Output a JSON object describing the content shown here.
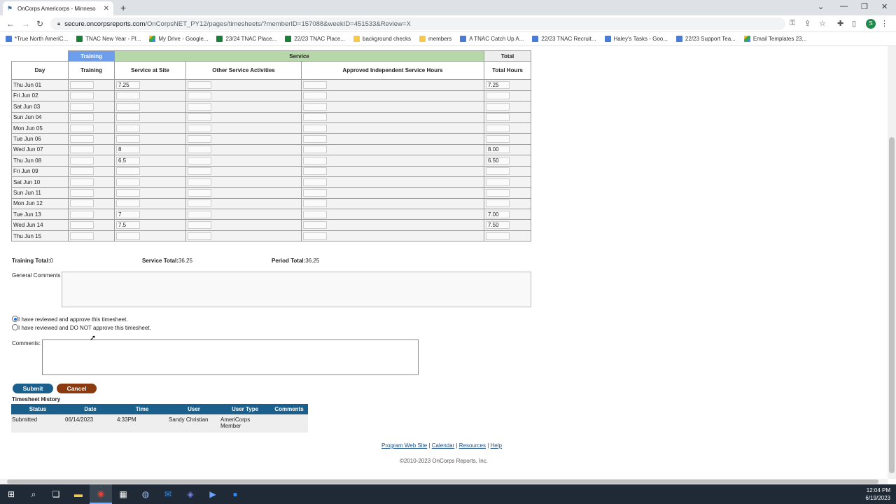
{
  "browser": {
    "tab_title": "OnCorps Americorps - Minneso",
    "url_host": "secure.oncorpsreports.com",
    "url_path": "/OnCorpsNET_PY12/pages/timesheets/?memberID=157088&weekID=451533&Review=X",
    "profile_letter": "S"
  },
  "bookmarks": [
    {
      "label": "*True North AmeriC...",
      "icon": "doc"
    },
    {
      "label": "TNAC New Year - Pl...",
      "icon": "grn"
    },
    {
      "label": "My Drive - Google...",
      "icon": "drv"
    },
    {
      "label": "23/24 TNAC Place...",
      "icon": "sht"
    },
    {
      "label": "22/23 TNAC Place...",
      "icon": "sht"
    },
    {
      "label": "background checks",
      "icon": "fld"
    },
    {
      "label": "members",
      "icon": "fld"
    },
    {
      "label": "A TNAC Catch Up A...",
      "icon": "doc"
    },
    {
      "label": "22/23 TNAC Recruit...",
      "icon": "doc"
    },
    {
      "label": "Haley's Tasks - Goo...",
      "icon": "doc"
    },
    {
      "label": "22/23 Support Tea...",
      "icon": "doc"
    },
    {
      "label": "Email Templates 23...",
      "icon": "drv"
    }
  ],
  "timesheet": {
    "group_headers": {
      "training": "Training",
      "service": "Service",
      "total": "Total"
    },
    "columns": {
      "day": "Day",
      "training": "Training",
      "service_at_site": "Service at Site",
      "other_service": "Other Service Activities",
      "approved_independent": "Approved Independent Service Hours",
      "total_hours": "Total Hours"
    },
    "rows": [
      {
        "day": "Thu Jun 01",
        "site": "7.25",
        "total": "7.25"
      },
      {
        "day": "Fri Jun 02",
        "site": "",
        "total": ""
      },
      {
        "day": "Sat Jun 03",
        "site": "",
        "total": ""
      },
      {
        "day": "Sun Jun 04",
        "site": "",
        "total": ""
      },
      {
        "day": "Mon Jun 05",
        "site": "",
        "total": ""
      },
      {
        "day": "Tue Jun 06",
        "site": "",
        "total": ""
      },
      {
        "day": "Wed Jun 07",
        "site": "8",
        "total": "8.00"
      },
      {
        "day": "Thu Jun 08",
        "site": "6.5",
        "total": "6.50"
      },
      {
        "day": "Fri Jun 09",
        "site": "",
        "total": ""
      },
      {
        "day": "Sat Jun 10",
        "site": "",
        "total": ""
      },
      {
        "day": "Sun Jun 11",
        "site": "",
        "total": ""
      },
      {
        "day": "Mon Jun 12",
        "site": "",
        "total": ""
      },
      {
        "day": "Tue Jun 13",
        "site": "7",
        "total": "7.00"
      },
      {
        "day": "Wed Jun 14",
        "site": "7.5",
        "total": "7.50"
      },
      {
        "day": "Thu Jun 15",
        "site": "",
        "total": ""
      }
    ]
  },
  "totals": {
    "training_label": "Training Total:",
    "training_value": "0",
    "service_label": "Service Total:",
    "service_value": "36.25",
    "period_label": "Period Total:",
    "period_value": "36.25"
  },
  "general_comments_label": "General Comments",
  "approval": {
    "approve_label": "I have reviewed and approve this timesheet.",
    "reject_label": "I have reviewed and DO NOT approve this timesheet.",
    "selected": "approve"
  },
  "comments_label": "Comments:",
  "buttons": {
    "submit": "Submit",
    "cancel": "Cancel"
  },
  "history": {
    "title": "Timesheet History",
    "headers": [
      "Status",
      "Date",
      "Time",
      "User",
      "User Type",
      "Comments"
    ],
    "rows": [
      {
        "status": "Submitted",
        "date": "06/14/2023",
        "time": "4:33PM",
        "user": "Sandy Christian",
        "user_type": "AmeriCorps Member",
        "comments": ""
      }
    ]
  },
  "footer": {
    "links": [
      "Program Web Site",
      "Calendar",
      "Resources",
      "Help"
    ],
    "copyright": "©2010-2023 OnCorps Reports, Inc."
  },
  "clock": {
    "time": "12:04 PM",
    "date": "6/19/2023"
  }
}
